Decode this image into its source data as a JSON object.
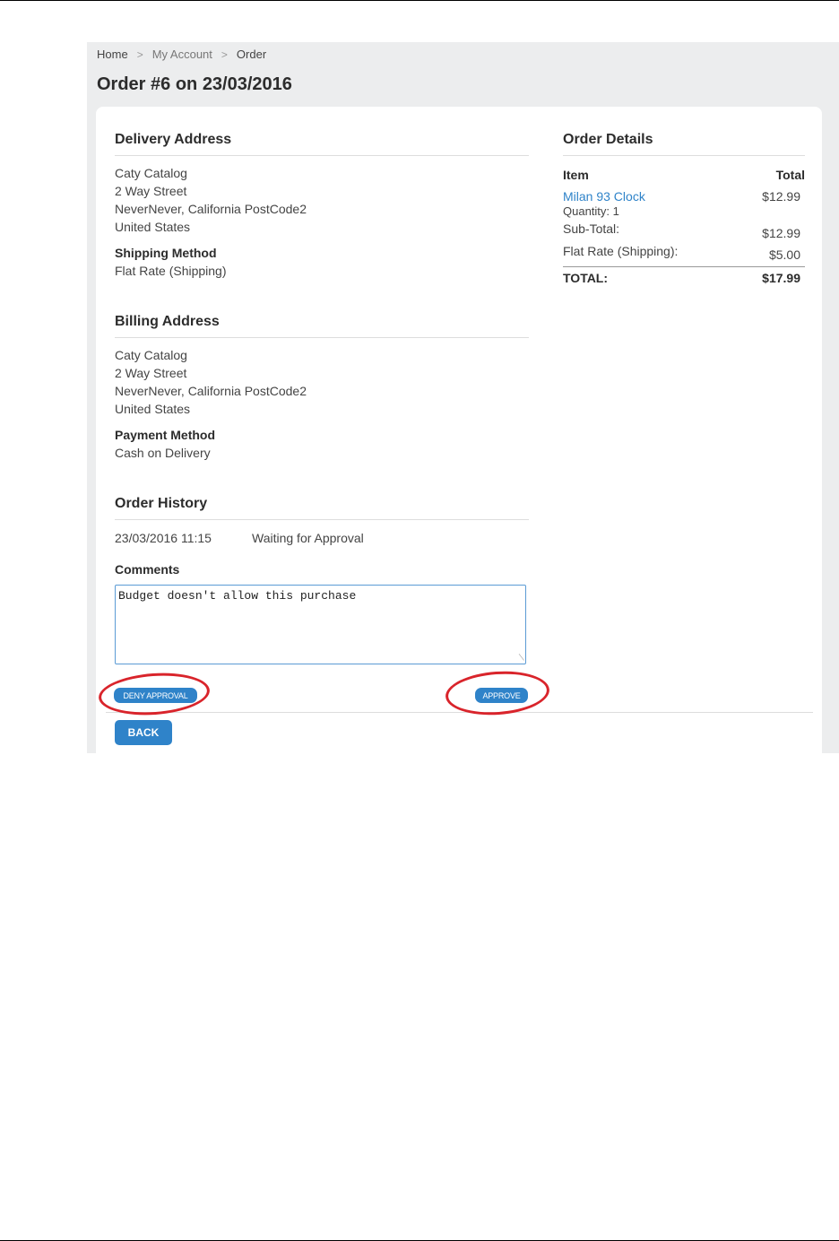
{
  "breadcrumb": {
    "home": "Home",
    "sep1": ">",
    "account": "My Account",
    "sep2": ">",
    "current": "Order"
  },
  "page_title": "Order #6 on 23/03/2016",
  "delivery": {
    "title": "Delivery Address",
    "name": "Caty Catalog",
    "street": "2 Way Street",
    "city_line": "NeverNever, California PostCode2",
    "country": "United States",
    "shipping_method_label": "Shipping Method",
    "shipping_method_value": "Flat Rate (Shipping)"
  },
  "billing": {
    "title": "Billing Address",
    "name": "Caty Catalog",
    "street": "2 Way Street",
    "city_line": "NeverNever, California PostCode2",
    "country": "United States",
    "payment_method_label": "Payment Method",
    "payment_method_value": "Cash on Delivery"
  },
  "history": {
    "title": "Order History",
    "entries": [
      {
        "date": "23/03/2016 11:15",
        "status": "Waiting for Approval"
      }
    ]
  },
  "comments": {
    "label": "Comments",
    "value": "Budget doesn't allow this purchase",
    "resize_icon": "resize-grip-icon"
  },
  "buttons": {
    "deny": "DENY APPROVAL",
    "approve": "APPROVE",
    "back": "BACK"
  },
  "order_details": {
    "title": "Order Details",
    "col_item": "Item",
    "col_total": "Total",
    "item_name": "Milan 93 Clock",
    "item_price": "$12.99",
    "item_quantity": "Quantity: 1",
    "subtotal_label": "Sub-Total:",
    "subtotal_value": "$12.99",
    "shipping_label": "Flat Rate (Shipping):",
    "shipping_value": "$5.00",
    "total_label": "TOTAL:",
    "total_value": "$17.99"
  },
  "colors": {
    "accent": "#2f83c9",
    "highlight": "#d9242b",
    "background": "#ecedee"
  }
}
